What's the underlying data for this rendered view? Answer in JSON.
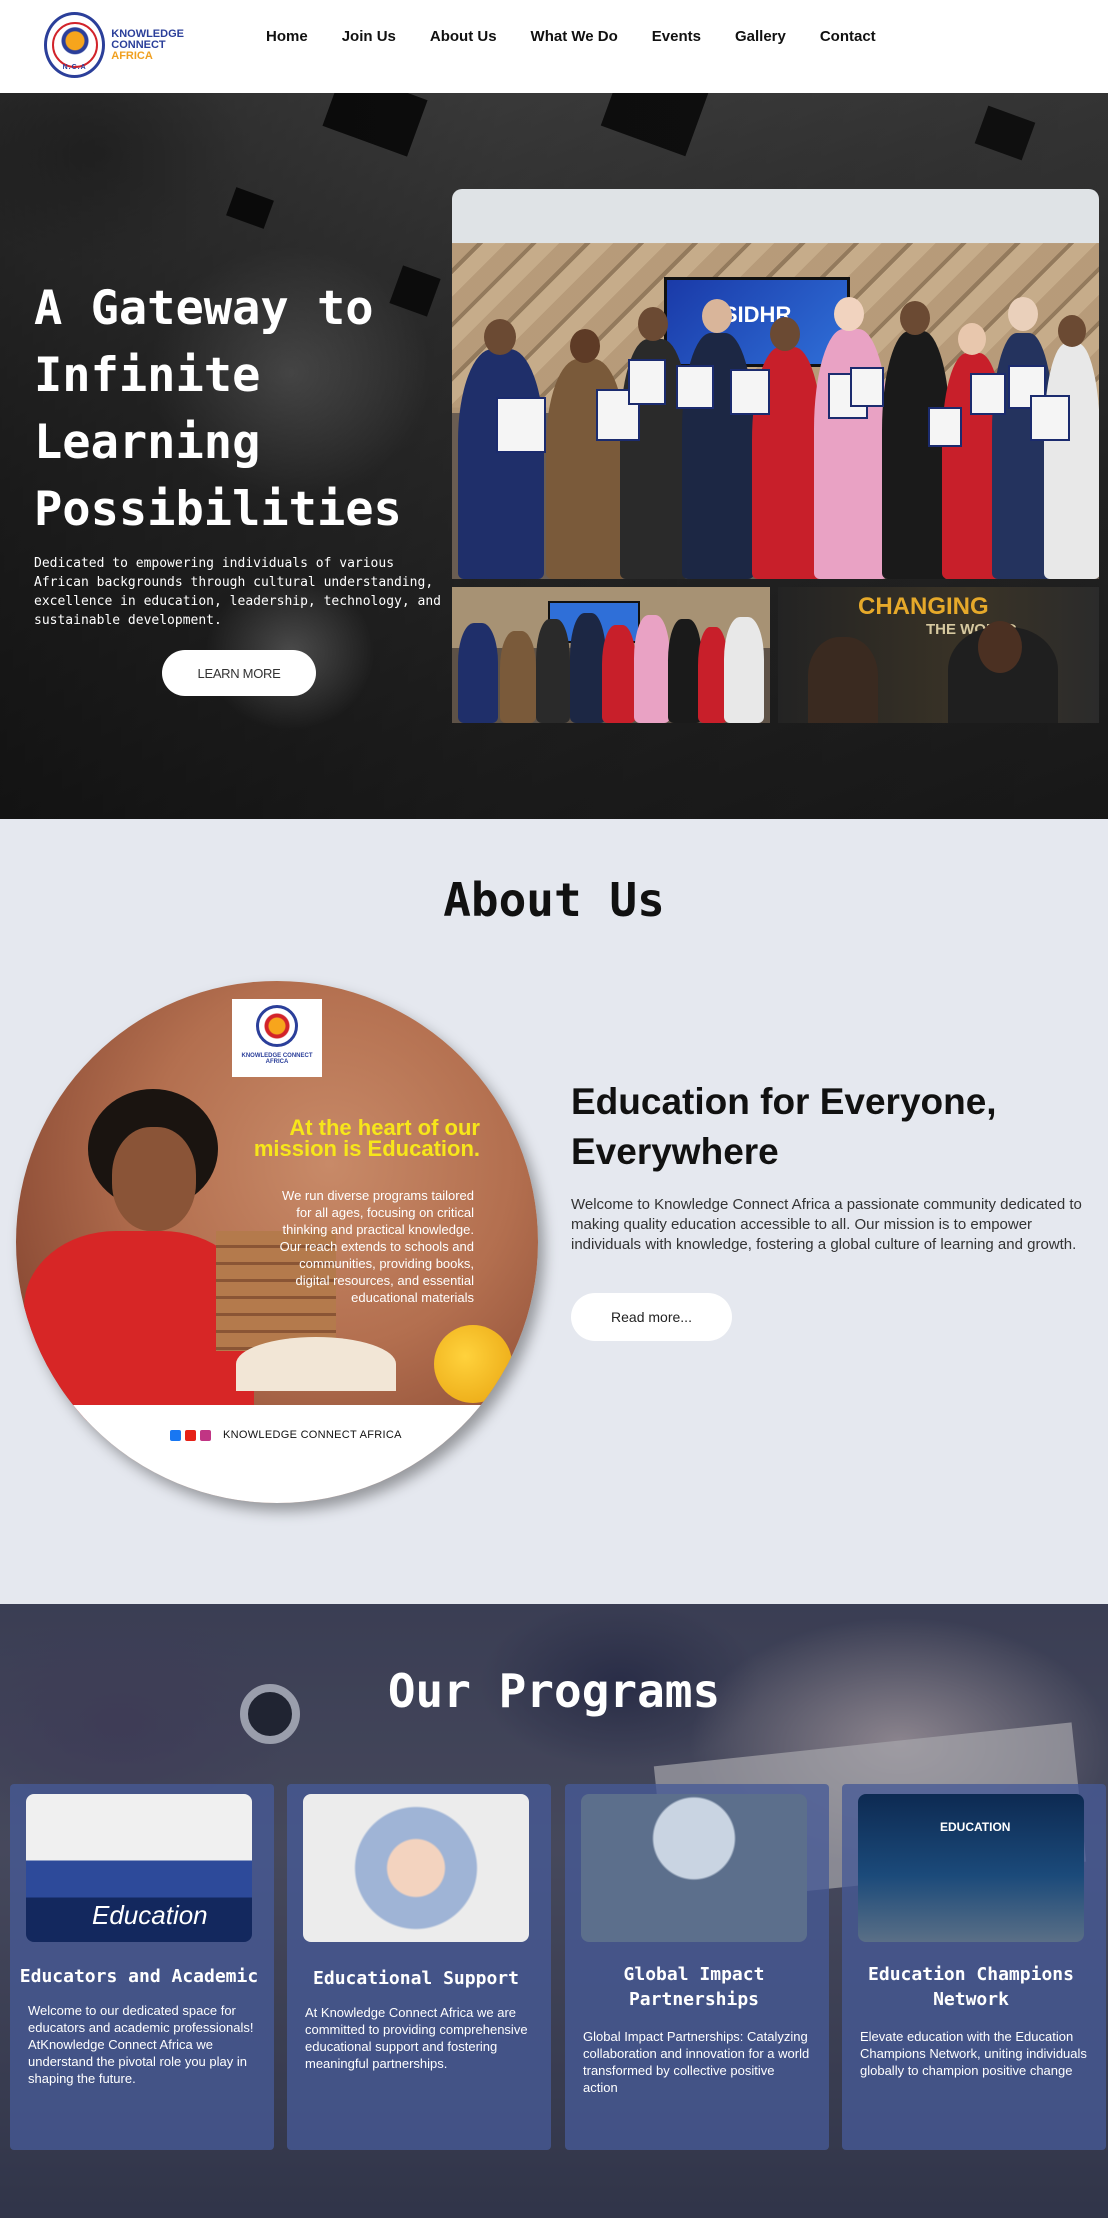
{
  "nav": {
    "logo_line1": "KNOWLEDGE",
    "logo_line2": "CONNECT",
    "logo_line3": "AFRICA",
    "logo_seal_text": "N.C.A",
    "items": [
      "Home",
      "Join Us",
      "About Us",
      "What We Do",
      "Events",
      "Gallery",
      "Contact"
    ]
  },
  "hero": {
    "title": "A Gateway to Infinite Learning Possibilities",
    "description": "Dedicated to empowering individuals of various African backgrounds through cultural understanding, excellence in education, leadership, technology, and sustainable development.",
    "button": "LEARN MORE",
    "screen_text": "USIDHR",
    "photo_b_line1": "CHANGING",
    "photo_b_line2": "THE WORLD"
  },
  "about": {
    "title": "About Us",
    "poster": {
      "logo_text": "KNOWLEDGE CONNECT AFRICA",
      "headline": "At the heart of our mission is Education.",
      "body": "We run diverse programs tailored for all ages, focusing on critical thinking and practical knowledge. Our reach extends to schools and communities, providing books, digital resources, and essential educational materials",
      "footer": "KNOWLEDGE CONNECT AFRICA"
    },
    "heading": "Education for Everyone, Everywhere",
    "paragraph": "Welcome to Knowledge Connect Africa a passionate community dedicated to making quality education accessible to all. Our mission is to empower individuals with knowledge, fostering a global culture of learning and growth.",
    "button": "Read more..."
  },
  "programs": {
    "title": "Our Programs",
    "cards": [
      {
        "title": "Educators and Academic",
        "description": "Welcome to our dedicated space for educators and academic professionals! AtKnowledge Connect Africa we understand the pivotal role you play in shaping the future.",
        "image_text": "Education"
      },
      {
        "title": "Educational Support",
        "description": "At Knowledge Connect Africa we are committed to providing comprehensive educational support and fostering meaningful partnerships."
      },
      {
        "title": "Global Impact Partnerships",
        "description": "Global Impact Partnerships: Catalyzing collaboration and innovation for a world transformed by collective positive action"
      },
      {
        "title": "Education Champions Network",
        "description": "Elevate education with the Education Champions Network, uniting individuals globally to champion positive change",
        "image_text": "EDUCATION"
      }
    ]
  },
  "colors": {
    "brand_blue": "#2b3f9a",
    "brand_orange": "#f0a020",
    "about_bg": "#e5e8ef",
    "card_bg": "#4a5f99"
  }
}
